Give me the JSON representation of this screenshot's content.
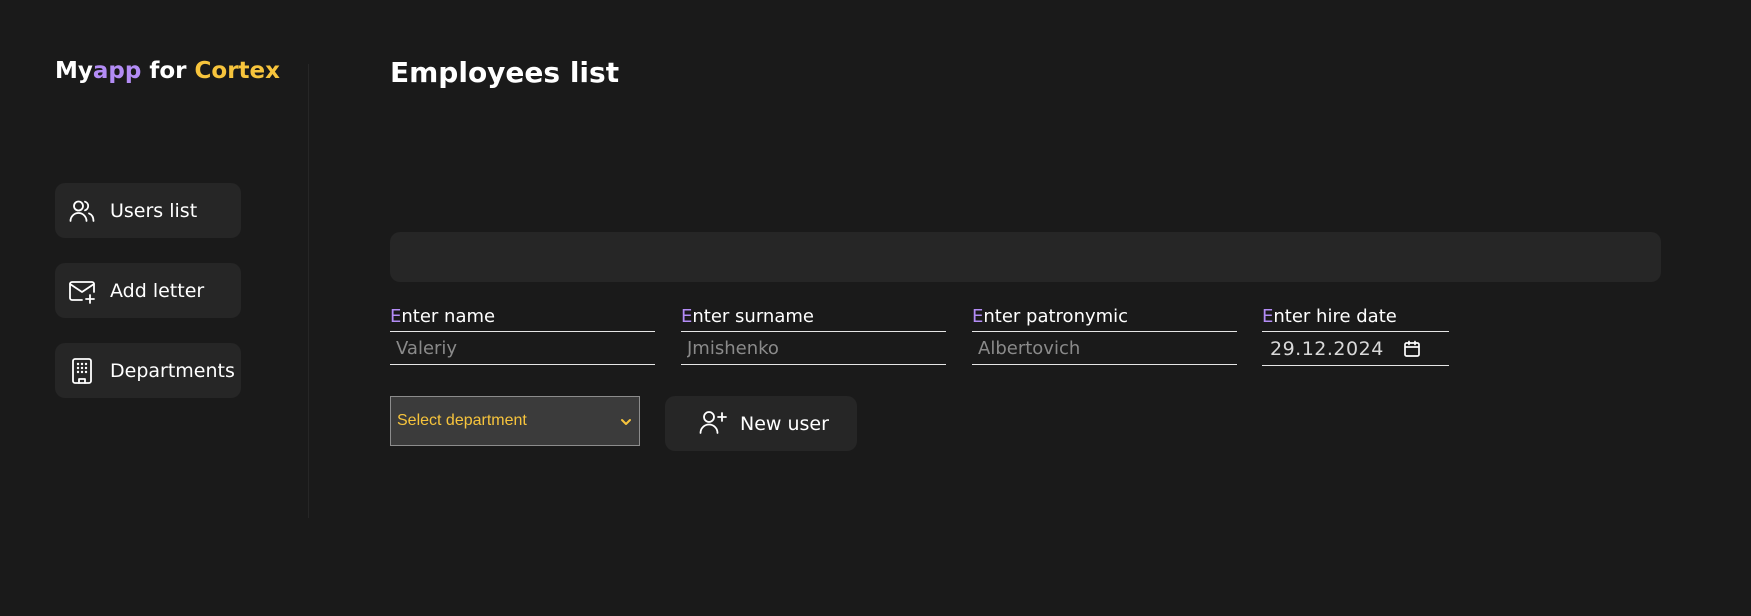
{
  "logo": {
    "part1": "My",
    "part2": "app",
    "part3": " for ",
    "part4": "Cortex"
  },
  "sidebar": {
    "items": [
      {
        "label": "Users list",
        "icon": "users-icon"
      },
      {
        "label": "Add letter",
        "icon": "mail-plus-icon"
      },
      {
        "label": "Departments",
        "icon": "building-icon"
      }
    ]
  },
  "main": {
    "title": "Employees list",
    "form": {
      "name": {
        "label_first": "E",
        "label_rest": "nter name",
        "placeholder": "Valeriy"
      },
      "surname": {
        "label_first": "E",
        "label_rest": "nter surname",
        "placeholder": "Jmishenko"
      },
      "patronymic": {
        "label_first": "E",
        "label_rest": "nter patronymic",
        "placeholder": "Albertovich"
      },
      "hire_date": {
        "label_first": "E",
        "label_rest": "nter hire date",
        "value": "29.12.2024",
        "icon": "calendar-icon"
      },
      "department": {
        "selected": "Select department",
        "icon": "chevron-down-icon"
      },
      "submit": {
        "label": "New user",
        "icon": "user-plus-icon"
      }
    }
  },
  "colors": {
    "background": "#1a1a1a",
    "surface": "#262626",
    "accent_purple": "#b38cf5",
    "accent_yellow": "#f7c43c"
  }
}
